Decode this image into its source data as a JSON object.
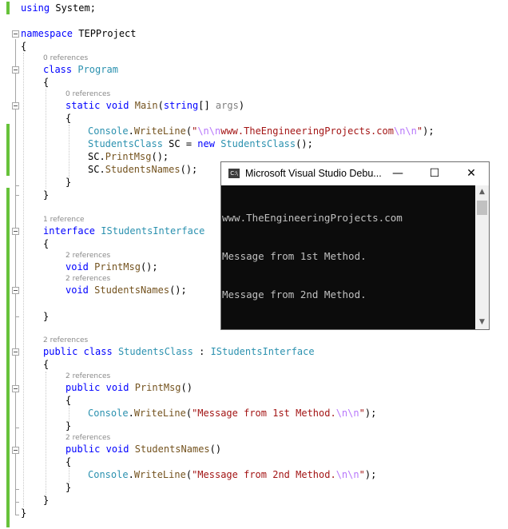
{
  "colors": {
    "keyword": "#0000ff",
    "type": "#2b91af",
    "method": "#74531f",
    "string": "#a31515",
    "escape": "#b776fb",
    "param": "#808080",
    "change_bar": "#67c23a",
    "console_bg": "#0c0c0c",
    "console_text": "#c0c0c0"
  },
  "code": {
    "l1": [
      "using",
      " System;"
    ],
    "l2": [
      "namespace",
      " TEPProject"
    ],
    "l3": "{",
    "ref_program": "0 references",
    "l4": [
      "class",
      " ",
      "Program"
    ],
    "l5": "{",
    "ref_main": "0 references",
    "l6": [
      "static",
      " ",
      "void",
      " ",
      "Main",
      "(",
      "string",
      "[] ",
      "args",
      ")"
    ],
    "l7": "{",
    "l8": [
      "Console",
      ".",
      "WriteLine",
      "(",
      "\"",
      "\\n\\n",
      "www.TheEngineeringProjects.com",
      "\\n\\n",
      "\"",
      ");"
    ],
    "l9": [
      "StudentsClass",
      " SC = ",
      "new",
      " ",
      "StudentsClass",
      "();"
    ],
    "l10": [
      "SC.",
      "PrintMsg",
      "();"
    ],
    "l11": [
      "SC.",
      "StudentsNames",
      "();"
    ],
    "l12": "}",
    "l13": "}",
    "ref_interface": "1 reference",
    "l14": [
      "interface",
      " ",
      "IStudentsInterface"
    ],
    "l15": "{",
    "ref_iprint": "2 references",
    "l16": [
      "void",
      " ",
      "PrintMsg",
      "();"
    ],
    "ref_inames": "2 references",
    "l17": [
      "void",
      " ",
      "StudentsNames",
      "();"
    ],
    "l18": "}",
    "ref_class": "2 references",
    "l19": [
      "public",
      " ",
      "class",
      " ",
      "StudentsClass",
      " : ",
      "IStudentsInterface"
    ],
    "l20": "{",
    "ref_print": "2 references",
    "l21": [
      "public",
      " ",
      "void",
      " ",
      "PrintMsg",
      "()"
    ],
    "l22": "{",
    "l23": [
      "Console",
      ".",
      "WriteLine",
      "(",
      "\"Message from 1st Method.",
      "\\n\\n",
      "\"",
      ");"
    ],
    "l24": "}",
    "ref_names": "2 references",
    "l25": [
      "public",
      " ",
      "void",
      " ",
      "StudentsNames",
      "()"
    ],
    "l26": "{",
    "l27": [
      "Console",
      ".",
      "WriteLine",
      "(",
      "\"Message from 2nd Method.",
      "\\n\\n",
      "\"",
      ");"
    ],
    "l28": "}",
    "l29": "}",
    "l30": "}"
  },
  "console": {
    "icon": "C:\\",
    "title": "Microsoft Visual Studio Debu...",
    "minimize": "—",
    "maximize": "☐",
    "close": "✕",
    "lines": [
      "www.TheEngineeringProjects.com",
      "Message from 1st Method.",
      "Message from 2nd Method."
    ],
    "scroll_up": "▲",
    "scroll_down": "▼"
  }
}
